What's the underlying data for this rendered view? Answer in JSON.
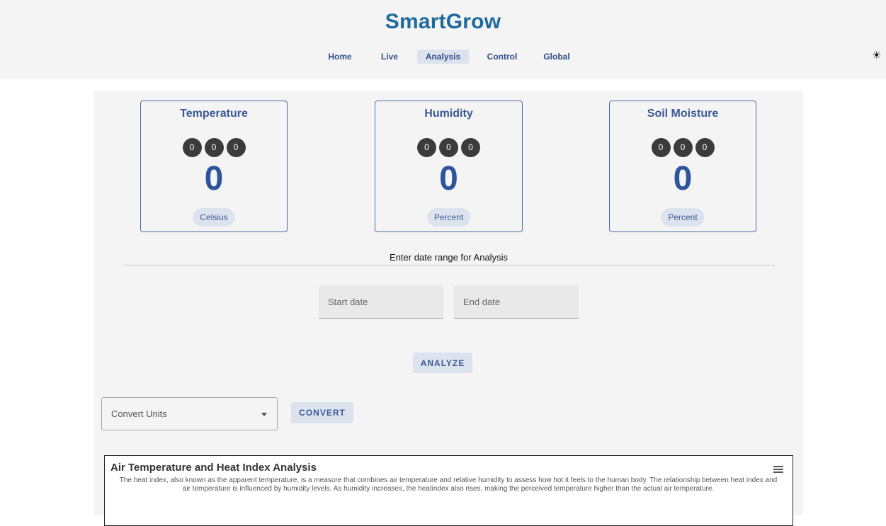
{
  "header": {
    "brand": "SmartGrow",
    "nav": [
      {
        "label": "Home",
        "active": false
      },
      {
        "label": "Live",
        "active": false
      },
      {
        "label": "Analysis",
        "active": true
      },
      {
        "label": "Control",
        "active": false
      },
      {
        "label": "Global",
        "active": false
      }
    ],
    "theme_icon": "sun-icon"
  },
  "cards": [
    {
      "title": "Temperature",
      "digits": [
        "0",
        "0",
        "0"
      ],
      "value": "0",
      "unit": "Celsius"
    },
    {
      "title": "Humidity",
      "digits": [
        "0",
        "0",
        "0"
      ],
      "value": "0",
      "unit": "Percent"
    },
    {
      "title": "Soil Moisture",
      "digits": [
        "0",
        "0",
        "0"
      ],
      "value": "0",
      "unit": "Percent"
    }
  ],
  "analysis": {
    "range_label": "Enter date range for Analysis",
    "start_placeholder": "Start date",
    "end_placeholder": "End date",
    "analyze_label": "ANALYZE"
  },
  "convert": {
    "select_label": "Convert Units",
    "button_label": "CONVERT"
  },
  "chart": {
    "title": "Air Temperature and Heat Index Analysis",
    "description": "The heat index, also known as the apparent temperature, is a measure that combines air temperature and relative humidity to assess how hot it feels to the human body. The relationship between heat index and air temperature is influenced by humidity levels. As humidity increases, the heatindex also rises, making the perceived temperature higher than the actual air temperature."
  },
  "colors": {
    "brand": "#1f6a9c",
    "accent": "#3a5a96",
    "chip_bg": "#dde3ee",
    "digit_bg": "#3b3b3b"
  }
}
